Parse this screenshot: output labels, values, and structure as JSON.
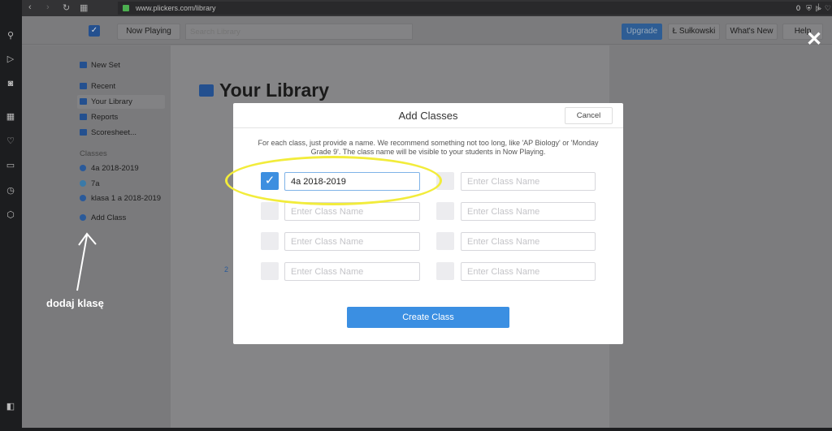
{
  "browser": {
    "url": "www.plickers.com/library",
    "counter": "0"
  },
  "header": {
    "now_playing": "Now Playing",
    "search_placeholder": "Search Library",
    "upgrade": "Upgrade",
    "user": "Ł Sułkowski",
    "whats_new": "What's New",
    "help": "Help"
  },
  "sidebar": {
    "new_set": "New Set",
    "recent": "Recent",
    "your_library": "Your Library",
    "reports": "Reports",
    "scoresheet": "Scoresheet...",
    "classes_label": "Classes",
    "classes": [
      "4a 2018-2019",
      "7a",
      "klasa 1 a 2018-2019"
    ],
    "add_class": "Add Class"
  },
  "main": {
    "title": "Your Library",
    "row_number": "2"
  },
  "modal": {
    "title": "Add Classes",
    "cancel": "Cancel",
    "description": "For each class, just provide a name. We recommend something not too long, like 'AP Biology' or 'Monday Grade 9'. The class name will be visible to your students in Now Playing.",
    "placeholder": "Enter Class Name",
    "first_value": "4a 2018-2019",
    "create": "Create Class"
  },
  "annotation": {
    "text": "dodaj klasę"
  },
  "colors": {
    "accent": "#3b8fe2",
    "highlight": "#f2ec3b"
  }
}
